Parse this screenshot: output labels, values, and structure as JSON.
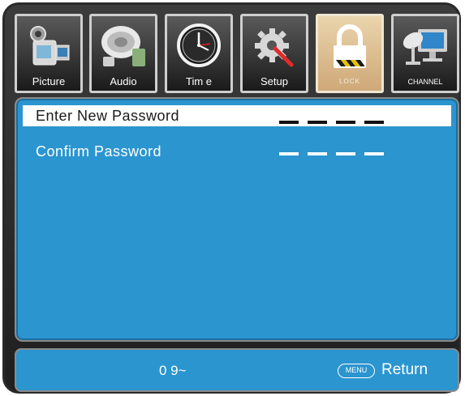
{
  "tabs": [
    {
      "label": "Picture",
      "icon": "camcorder-icon"
    },
    {
      "label": "Audio",
      "icon": "speaker-icon"
    },
    {
      "label": "Tim e",
      "icon": "clock-icon"
    },
    {
      "label": "Setup",
      "icon": "gear-wrench-icon"
    },
    {
      "label": "LOCK",
      "icon": "padlock-icon",
      "selected": true
    },
    {
      "label": "CHANNEL",
      "icon": "satellite-monitor-icon"
    }
  ],
  "menu": {
    "enter_new_password": {
      "label": "Enter New Password",
      "placeholder": "_ _ _ _"
    },
    "confirm_password": {
      "label": "Confirm Password",
      "placeholder": "_ _ _ _"
    }
  },
  "footer": {
    "hint": "0 9~",
    "menu_key": "MENU",
    "return_label": "Return"
  },
  "colors": {
    "panel_blue": "#2b95cf",
    "selected_tab": "#dcbf95",
    "frame": "#2a2a2a"
  }
}
